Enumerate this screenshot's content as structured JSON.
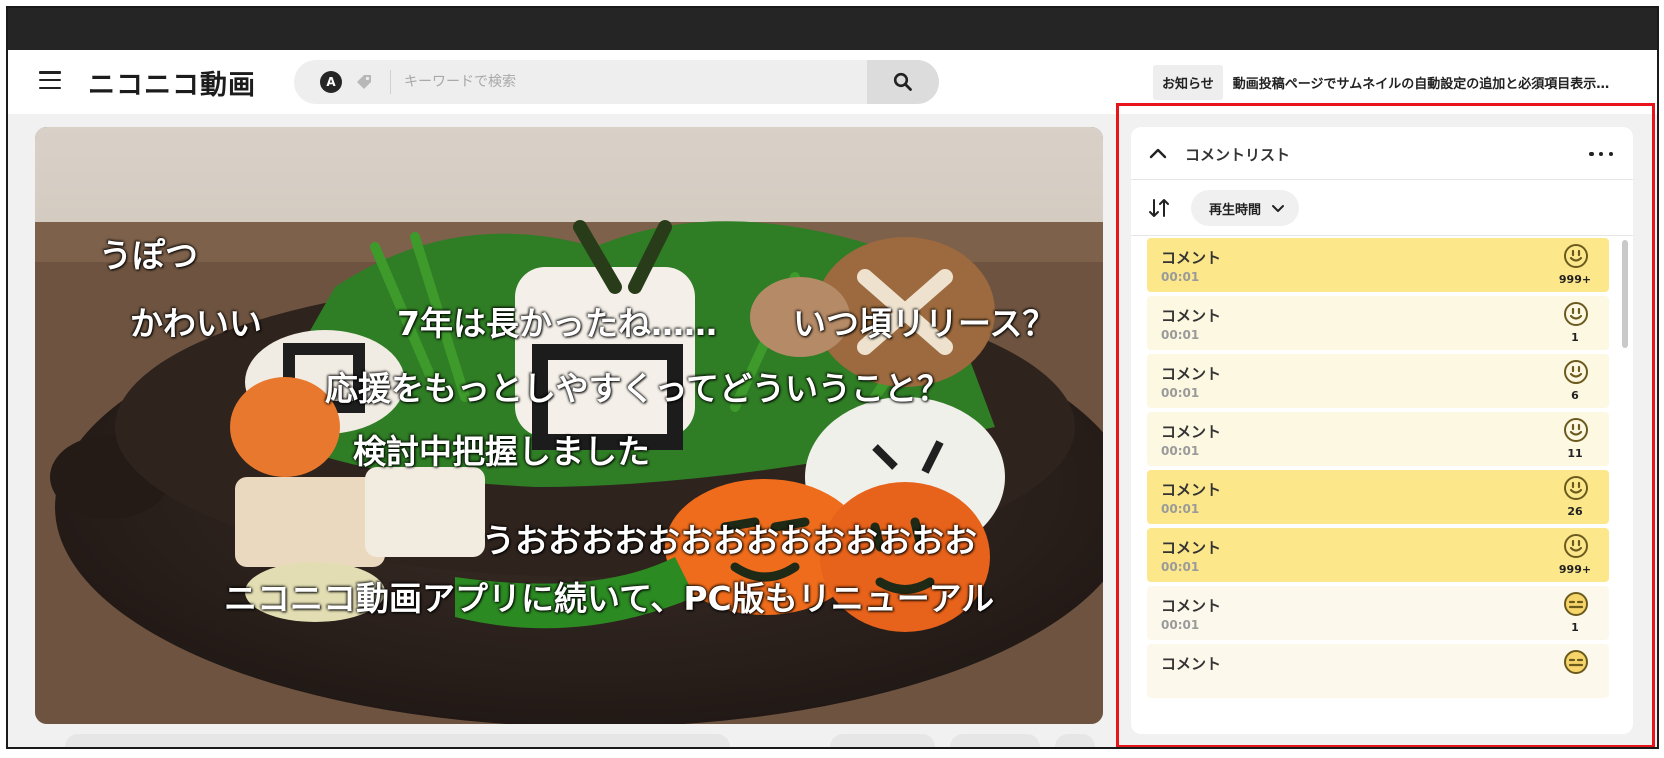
{
  "header": {
    "logo_text": "ニコニコ動画",
    "search": {
      "placeholder": "キーワードで検索",
      "mode_icon": "A"
    },
    "notice": {
      "badge": "お知らせ",
      "text": "動画投稿ページでサムネイルの自動設定の追加と必須項目表示…"
    }
  },
  "video": {
    "comments_overlay": [
      "うぽつ",
      "かわいい",
      "7年は長かったね……",
      "いつ頃リリース？",
      "応援をもっとしやすくってどういうこと？",
      "検討中把握しました",
      "うおおおおおおおおおおおおおお",
      "ニコニコ動画アプリに続いて、PC版もリニューアル"
    ]
  },
  "comment_panel": {
    "title": "コメントリスト",
    "sort_label": "再生時間",
    "comments": [
      {
        "text": "コメント",
        "time": "00:01",
        "count": "999+",
        "reaction": "smile",
        "shade": "hot"
      },
      {
        "text": "コメント",
        "time": "00:01",
        "count": "1",
        "reaction": "smile",
        "shade": "warm"
      },
      {
        "text": "コメント",
        "time": "00:01",
        "count": "6",
        "reaction": "smile",
        "shade": "warm"
      },
      {
        "text": "コメント",
        "time": "00:01",
        "count": "11",
        "reaction": "smile",
        "shade": "warm"
      },
      {
        "text": "コメント",
        "time": "00:01",
        "count": "26",
        "reaction": "smile",
        "shade": "hot"
      },
      {
        "text": "コメント",
        "time": "00:01",
        "count": "999+",
        "reaction": "smile",
        "shade": "hot"
      },
      {
        "text": "コメント",
        "time": "00:01",
        "count": "1",
        "reaction": "neutral",
        "shade": "cool"
      },
      {
        "text": "コメント",
        "time": "",
        "count": "",
        "reaction": "neutral",
        "shade": "cool"
      }
    ]
  },
  "colors": {
    "topbar": "#252525",
    "accent_outline": "#e8141b",
    "comment_hot": "#fde78b",
    "comment_warm": "#fdf8e2",
    "reaction_icon": "#6b5a1e"
  }
}
